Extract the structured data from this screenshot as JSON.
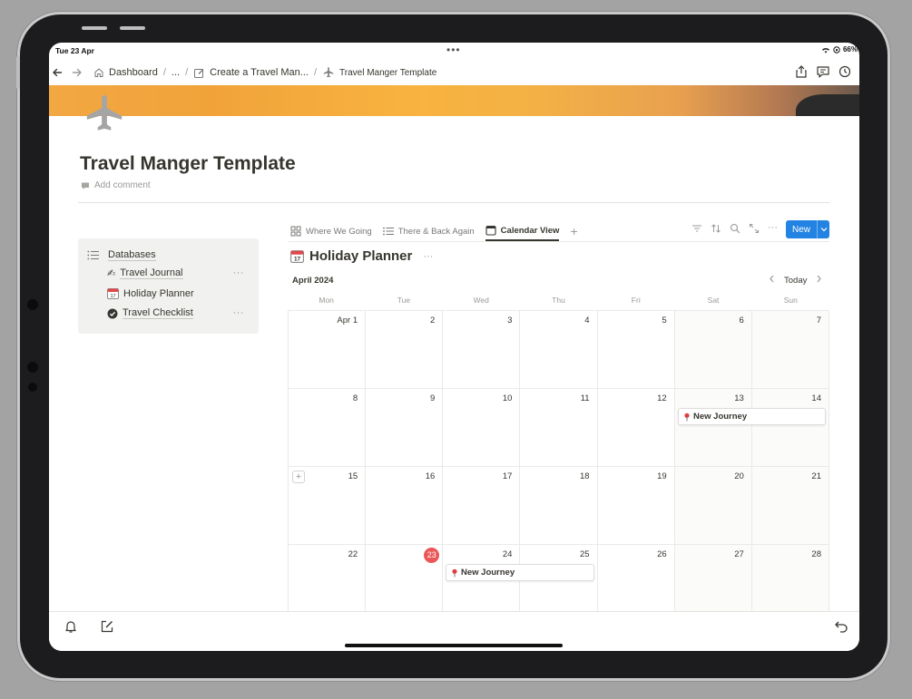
{
  "status": {
    "time": "Tue 23 Apr",
    "battery": "66%"
  },
  "nav": {
    "crumbs": [
      {
        "label": "Dashboard"
      },
      {
        "label": "..."
      },
      {
        "label": "Create a Travel Man..."
      },
      {
        "label": "Travel Manger Template"
      }
    ]
  },
  "page": {
    "title": "Travel Manger Template",
    "add_comment": "Add comment"
  },
  "databases": {
    "heading": "Databases",
    "items": [
      {
        "label": "Travel Journal",
        "icon": "writing-hand-icon"
      },
      {
        "label": "Holiday Planner",
        "icon": "calendar-icon"
      },
      {
        "label": "Travel Checklist",
        "icon": "check-circle-icon"
      }
    ]
  },
  "views": {
    "tabs": [
      {
        "label": "Where We Going",
        "icon": "gallery-icon"
      },
      {
        "label": "There & Back Again",
        "icon": "list-icon"
      },
      {
        "label": "Calendar View",
        "icon": "calendar-icon",
        "active": true
      }
    ],
    "new_label": "New"
  },
  "calendar": {
    "title": "Holiday Planner",
    "month": "April 2024",
    "today_label": "Today",
    "weekdays": [
      "Mon",
      "Tue",
      "Wed",
      "Thu",
      "Fri",
      "Sat",
      "Sun"
    ],
    "weeks": [
      [
        "Apr 1",
        "2",
        "3",
        "4",
        "5",
        "6",
        "7"
      ],
      [
        "8",
        "9",
        "10",
        "11",
        "12",
        "13",
        "14"
      ],
      [
        "15",
        "16",
        "17",
        "18",
        "19",
        "20",
        "21"
      ],
      [
        "22",
        "23",
        "24",
        "25",
        "26",
        "27",
        "28"
      ]
    ],
    "today": "23",
    "events": [
      {
        "title": "New Journey",
        "start": "13",
        "end": "14"
      },
      {
        "title": "New Journey",
        "start": "24",
        "end": "25"
      }
    ]
  },
  "colors": {
    "accent": "#2383e2",
    "today": "#eb5757"
  }
}
